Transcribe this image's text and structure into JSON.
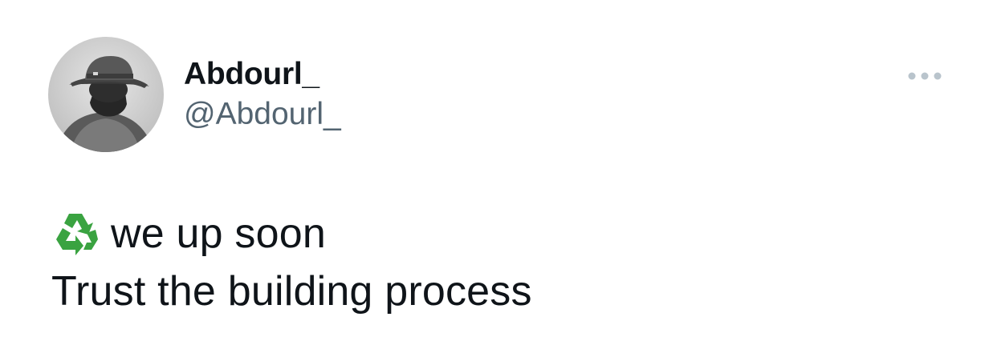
{
  "tweet": {
    "display_name": "Abdourl_",
    "handle": "@Abdourl_",
    "line1": "we up soon",
    "line2": "Trust the building process"
  },
  "icons": {
    "avatar": "masked-person-bucket-hat-avatar",
    "more": "more-options-icon",
    "emoji": "recycle-symbol-emoji"
  },
  "colors": {
    "name": "#0f1419",
    "handle": "#536471",
    "more_dots": "#b9c4cc",
    "recycle_green": "#3aa341"
  }
}
